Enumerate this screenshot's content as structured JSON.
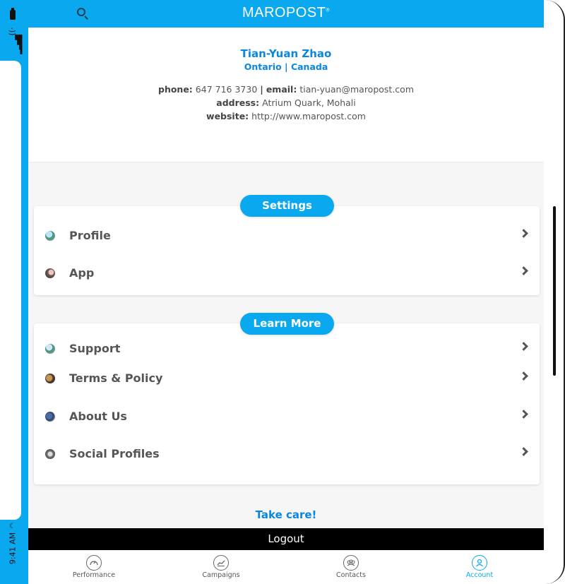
{
  "status_bar": {
    "time": "9:41 AM"
  },
  "header": {
    "brand": "MAROPOST",
    "brand_mark": "®"
  },
  "profile": {
    "name": "Tian-Yuan Zhao",
    "location": "Ontario | Canada",
    "phone_label": "phone:",
    "phone": "647 716 3730",
    "separator": "|",
    "email_label": "email:",
    "email": "tian-yuan@maropost.com",
    "address_label": "address:",
    "address": "Atrium Quark, Mohali",
    "website_label": "website:",
    "website": "http://www.maropost.com"
  },
  "settings": {
    "title": "Settings",
    "items": [
      {
        "label": "Profile",
        "icon": "profile-avatar-icon"
      },
      {
        "label": "App",
        "icon": "app-avatar-icon"
      }
    ]
  },
  "learn_more": {
    "title": "Learn More",
    "items": [
      {
        "label": "Support",
        "icon": "support-avatar-icon"
      },
      {
        "label": "Terms & Policy",
        "icon": "terms-avatar-icon"
      },
      {
        "label": "About Us",
        "icon": "about-avatar-icon"
      },
      {
        "label": "Social Profiles",
        "icon": "social-avatar-icon"
      }
    ]
  },
  "footer": {
    "take_care": "Take care!",
    "logout": "Logout"
  },
  "tabs": [
    {
      "label": "Performance",
      "icon": "gauge-icon"
    },
    {
      "label": "Campaigns",
      "icon": "chart-icon"
    },
    {
      "label": "Contacts",
      "icon": "group-icon"
    },
    {
      "label": "Account",
      "icon": "user-icon",
      "active": true
    }
  ],
  "colors": {
    "accent": "#0aa8ee",
    "link": "#0a86e0",
    "logout_bg": "#000000"
  }
}
